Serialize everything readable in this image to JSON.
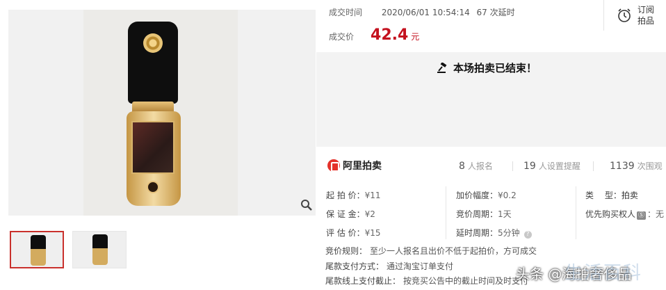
{
  "deal": {
    "time_label": "成交时间",
    "time_value": "2020/06/01 10:54:14",
    "delay_count": "67 次延时",
    "price_label": "成交价",
    "price_value": "42.4",
    "price_unit": "元"
  },
  "subscribe": {
    "label": "订阅拍品",
    "icon": "alarm-clock-icon"
  },
  "status": {
    "ended_text": "本场拍卖已结束！",
    "icon": "gavel-icon"
  },
  "platform": {
    "name": "阿里拍卖",
    "stats": [
      {
        "num": "8",
        "text": "人报名"
      },
      {
        "num": "19",
        "text": "人设置提醒"
      },
      {
        "num": "1139",
        "text": "次围观"
      }
    ]
  },
  "details": {
    "col1": [
      {
        "k": "起 拍 价：",
        "v": "¥11"
      },
      {
        "k": "保 证 金：",
        "v": "¥2"
      },
      {
        "k": "评 估 价：",
        "v": "¥15"
      }
    ],
    "col2": [
      {
        "k": "加价幅度：",
        "v": "¥0.2"
      },
      {
        "k": "竞价周期：",
        "v": "1天"
      },
      {
        "k": "延时周期：",
        "v": "5分钟"
      }
    ],
    "type_key": "类　 型：",
    "type_val": "拍卖",
    "priority_key": "优先购买权人",
    "priority_badge": "Ⓢ",
    "priority_val": "：无"
  },
  "rules": [
    {
      "k": "竞价规则：",
      "v": "至少一人报名且出价不低于起拍价，方可成交"
    },
    {
      "k": "尾款支付方式：",
      "v": "通过淘宝订单支付"
    },
    {
      "k": "尾款线上支付截止：",
      "v": "按竞买公告中的截止时间及时支付"
    }
  ],
  "watermark": {
    "text": "头条 @海拍奢侈品",
    "ghost": "生活百科"
  },
  "colors": {
    "price": "#c4121f",
    "brand": "#e4322b",
    "thumb_active_border": "#c9302c"
  }
}
